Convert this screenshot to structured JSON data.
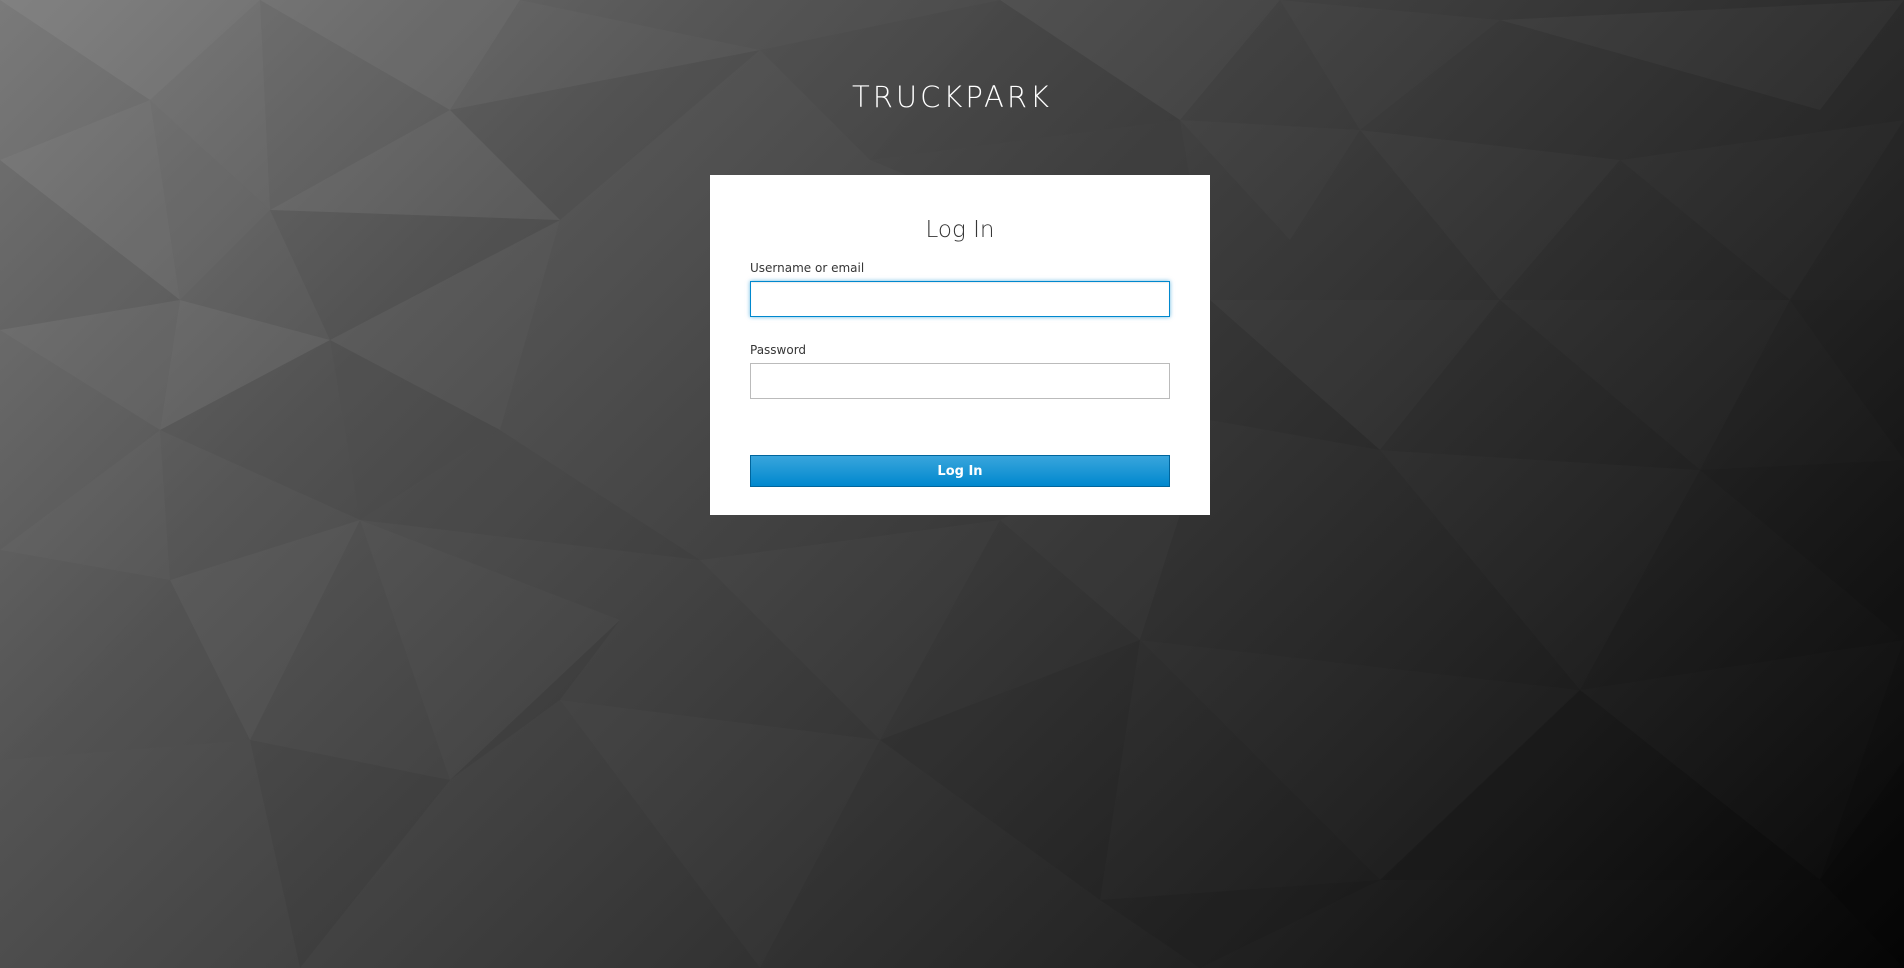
{
  "app": {
    "title": "TRUCKPARK"
  },
  "login": {
    "heading": "Log In",
    "username_label": "Username or email",
    "username_value": "",
    "password_label": "Password",
    "password_value": "",
    "submit_label": "Log In"
  },
  "colors": {
    "accent": "#0088ce",
    "accent_light": "#39a5dc",
    "card_background": "#ffffff",
    "page_background_light": "#7a7a7a",
    "page_background_dark": "#050505"
  }
}
